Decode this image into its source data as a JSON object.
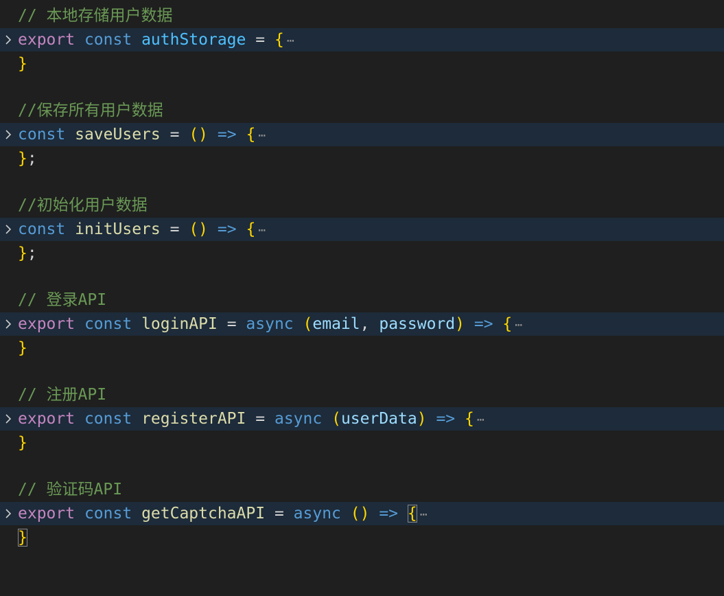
{
  "icons": {
    "fold": "chevron-right-icon",
    "fold_color": "#cccccc"
  },
  "colors": {
    "background": "#1f1f1f",
    "folded_line_bg": "#1d2b3a",
    "comment": "#6a9955",
    "keyword_export": "#c586c0",
    "keyword": "#569cd6",
    "identifier": "#9cdcfe",
    "brace": "#ffd700"
  },
  "lines": [
    {
      "comment": "// 本地存储用户数据"
    },
    {
      "export": "export",
      "const": "const",
      "name": "authStorage",
      "eq": "=",
      "open": "{",
      "ellipsis": "⋯"
    },
    {
      "close": "}"
    },
    {
      "comment": "//保存所有用户数据"
    },
    {
      "const": "const",
      "name": "saveUsers",
      "eq": "=",
      "params": "()",
      "arrow": "=>",
      "open": "{",
      "ellipsis": "⋯"
    },
    {
      "close": "}",
      "semi": ";"
    },
    {
      "comment": "//初始化用户数据"
    },
    {
      "const": "const",
      "name": "initUsers",
      "eq": "=",
      "params": "()",
      "arrow": "=>",
      "open": "{",
      "ellipsis": "⋯"
    },
    {
      "close": "}",
      "semi": ";"
    },
    {
      "comment": "// 登录API"
    },
    {
      "export": "export",
      "const": "const",
      "name": "loginAPI",
      "eq": "=",
      "async": "async",
      "paren_open": "(",
      "param1": "email",
      "comma": ",",
      "param2": "password",
      "paren_close": ")",
      "arrow": "=>",
      "open": "{",
      "ellipsis": "⋯"
    },
    {
      "close": "}"
    },
    {
      "comment": "// 注册API"
    },
    {
      "export": "export",
      "const": "const",
      "name": "registerAPI",
      "eq": "=",
      "async": "async",
      "paren_open": "(",
      "param1": "userData",
      "paren_close": ")",
      "arrow": "=>",
      "open": "{",
      "ellipsis": "⋯"
    },
    {
      "close": "}"
    },
    {
      "comment": "// 验证码API"
    },
    {
      "export": "export",
      "const": "const",
      "name": "getCaptchaAPI",
      "eq": "=",
      "async": "async",
      "params": "()",
      "arrow": "=>",
      "open": "{",
      "ellipsis": "⋯"
    },
    {
      "close": "}"
    }
  ]
}
